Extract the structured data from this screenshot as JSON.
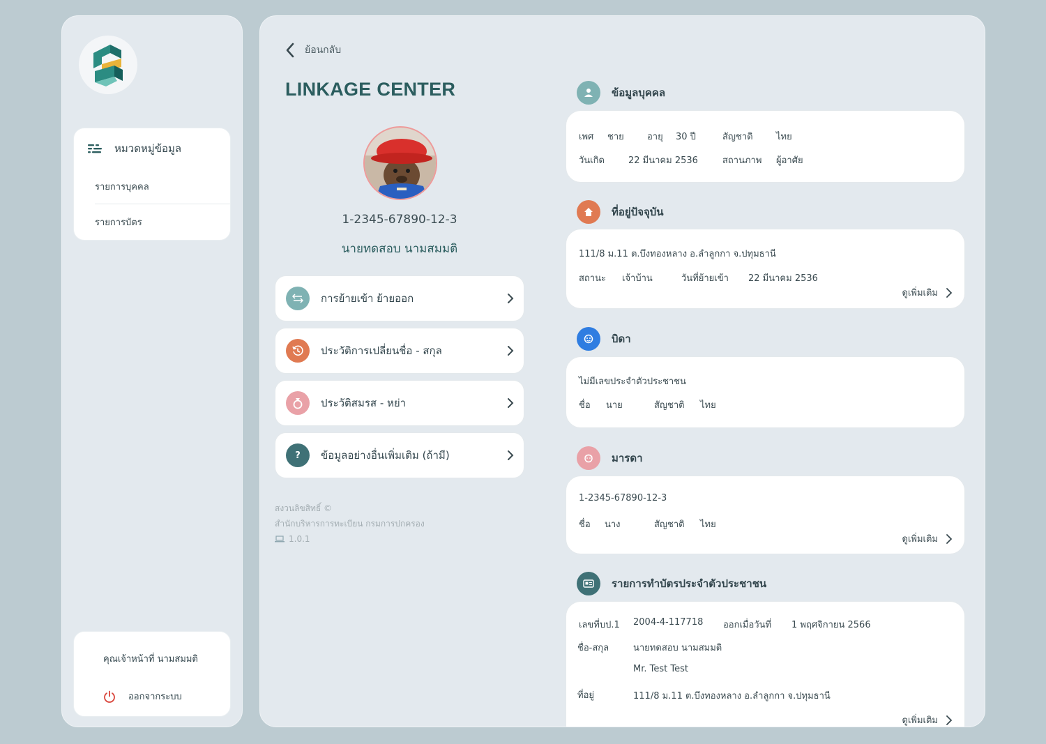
{
  "sidebar": {
    "menu_title": "หมวดหมู่ข้อมูล",
    "items": [
      {
        "label": "รายการบุคคล"
      },
      {
        "label": "รายการบัตร"
      }
    ],
    "user_label": "คุณเจ้าหน้าที่  นามสมมติ",
    "logout_label": "ออกจากระบบ"
  },
  "main": {
    "back_label": "ย้อนกลับ",
    "brand": "LINKAGE CENTER",
    "person_id": "1-2345-67890-12-3",
    "person_name": "นายทดสอบ  นามสมมติ",
    "nav": [
      {
        "label": "การย้ายเข้า ย้ายออก",
        "icon": "transfer-icon",
        "color": "#7fb2b3"
      },
      {
        "label": "ประวัติการเปลี่ยนชื่อ - สกุล",
        "icon": "history-icon",
        "color": "#e07a52"
      },
      {
        "label": "ประวัติสมรส - หย่า",
        "icon": "ring-icon",
        "color": "#e9a1a7"
      },
      {
        "label": "ข้อมูลอย่างอื่นเพิ่มเติม (ถ้ามี)",
        "icon": "question-icon",
        "color": "#3f7176"
      }
    ],
    "footer": {
      "copyright": "สงวนลิขสิทธิ์ ©",
      "org": "สำนักบริหารการทะเบียน กรมการปกครอง",
      "version": "1.0.1"
    }
  },
  "sections": {
    "personal": {
      "title": "ข้อมูลบุคคล",
      "color": "#7fb2b3",
      "gender_label": "เพศ",
      "gender": "ชาย",
      "age_label": "อายุ",
      "age": "30  ปี",
      "nationality_label": "สัญชาติ",
      "nationality": "ไทย",
      "birth_label": "วันเกิด",
      "birth": "22  มีนาคม  2536",
      "status_label": "สถานภาพ",
      "status": "ผู้อาศัย"
    },
    "address": {
      "title": "ที่อยู่ปัจจุบัน",
      "color": "#e07a52",
      "address": "111/8 ม.11 ต.บึงทองหลาง อ.ลำลูกกา จ.ปทุมธานี",
      "status_label": "สถานะ",
      "status": "เจ้าบ้าน",
      "move_label": "วันที่ย้ายเข้า",
      "move_date": "22 มีนาคม 2536",
      "more": "ดูเพิ่มเติม"
    },
    "father": {
      "title": "บิดา",
      "color": "#2f7de1",
      "id_text": "ไม่มีเลขประจำตัวประชาชน",
      "name_label": "ชื่อ",
      "name": "นาย",
      "nationality_label": "สัญชาติ",
      "nationality": "ไทย"
    },
    "mother": {
      "title": "มารดา",
      "color": "#e9a1a7",
      "id_text": "1-2345-67890-12-3",
      "name_label": "ชื่อ",
      "name": "นาง",
      "nationality_label": "สัญชาติ",
      "nationality": "ไทย",
      "more": "ดูเพิ่มเติม"
    },
    "card": {
      "title": "รายการทำบัตรประจำตัวประชาชน",
      "color": "#3f7176",
      "no_label": "เลขที่บป.1",
      "no": "2004-4-117718",
      "issue_label": "ออกเมื่อวันที่",
      "issue_date": "1 พฤศจิกายน 2566",
      "name_label": "ชื่อ-สกุล",
      "name_th": "นายทดสอบ  นามสมมติ",
      "name_en": "Mr. Test  Test",
      "addr_label": "ที่อยู่",
      "address": "111/8 ม.11 ต.บึงทองหลาง อ.ลำลูกกา จ.ปทุมธานี",
      "more": "ดูเพิ่มเติม"
    }
  }
}
